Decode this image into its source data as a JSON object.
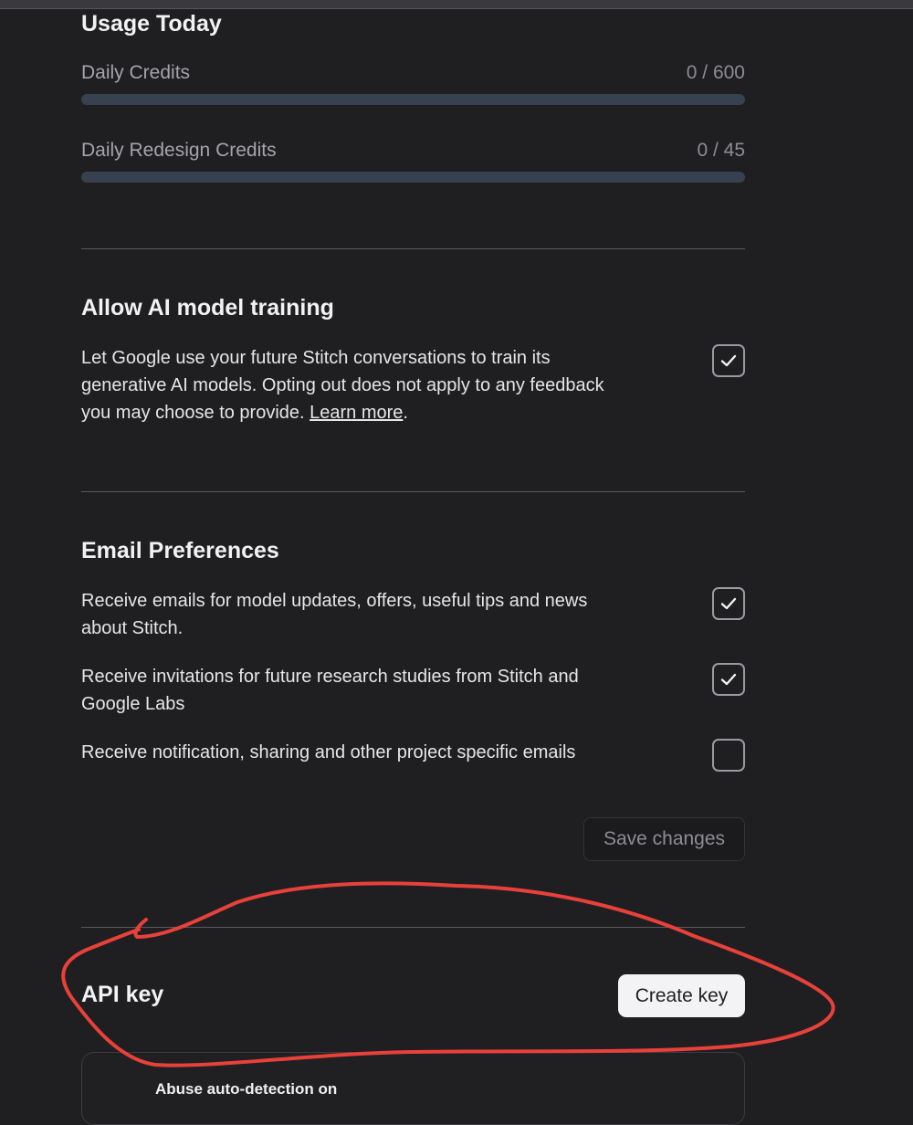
{
  "usage": {
    "title": "Usage Today",
    "daily_credits": {
      "label": "Daily Credits",
      "value": "0 / 600",
      "progress_fraction": 0
    },
    "redesign_credits": {
      "label": "Daily Redesign Credits",
      "value": "0 / 45",
      "progress_fraction": 0
    }
  },
  "training": {
    "title": "Allow AI model training",
    "line1": "Let Google use your future Stitch conversations to train its",
    "line2": "generative AI models. Opting out does not apply to any feedback",
    "line3_prefix": "you may choose to provide. ",
    "learn_more": "Learn more",
    "line3_suffix": ".",
    "checked": true
  },
  "email": {
    "title": "Email Preferences",
    "options": [
      {
        "line1": "Receive emails for model updates, offers, useful tips and news",
        "line2": "about Stitch.",
        "checked": true
      },
      {
        "line1": "Receive invitations for future research studies from Stitch and",
        "line2": "Google Labs",
        "checked": true
      },
      {
        "line1": "Receive notification, sharing and other project specific emails",
        "line2": "",
        "checked": false
      }
    ],
    "save_label": "Save changes"
  },
  "api": {
    "title": "API key",
    "create_label": "Create key",
    "abuse_text": "Abuse auto-detection on"
  },
  "colors": {
    "background": "#1f1f22",
    "progress_track": "#38414f",
    "annotation_red": "#e8413a"
  },
  "icons": {
    "check": "checkmark-icon"
  }
}
